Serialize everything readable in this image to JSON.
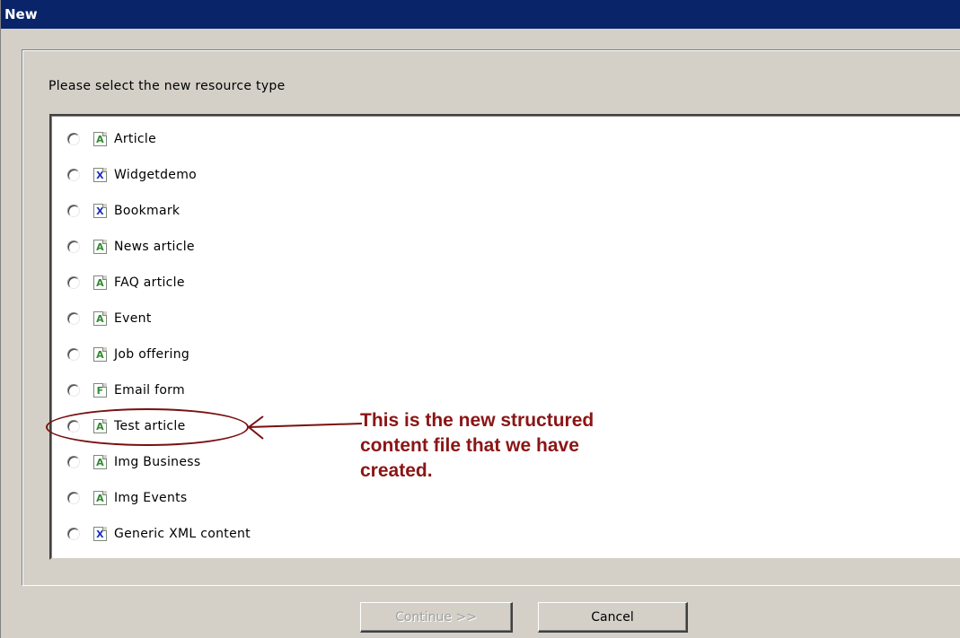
{
  "window": {
    "title": "New"
  },
  "dialog": {
    "prompt": "Please select the new resource type"
  },
  "resource_types": [
    {
      "label": "Article",
      "icon": "article-icon",
      "glyph": "A"
    },
    {
      "label": "Widgetdemo",
      "icon": "xml-icon",
      "glyph": "X"
    },
    {
      "label": "Bookmark",
      "icon": "xml-icon",
      "glyph": "X"
    },
    {
      "label": "News article",
      "icon": "article-icon",
      "glyph": "A"
    },
    {
      "label": "FAQ article",
      "icon": "article-icon",
      "glyph": "A"
    },
    {
      "label": "Event",
      "icon": "article-icon",
      "glyph": "A"
    },
    {
      "label": "Job offering",
      "icon": "article-icon",
      "glyph": "A"
    },
    {
      "label": "Email form",
      "icon": "form-icon",
      "glyph": "F"
    },
    {
      "label": "Test article",
      "icon": "article-icon",
      "glyph": "A"
    },
    {
      "label": "Img Business",
      "icon": "article-icon",
      "glyph": "A"
    },
    {
      "label": "Img Events",
      "icon": "article-icon",
      "glyph": "A"
    },
    {
      "label": "Generic XML content",
      "icon": "xml-icon",
      "glyph": "X"
    }
  ],
  "annotation": {
    "text_line1": "This is the new structured",
    "text_line2": "content file that we have",
    "text_line3": "created.",
    "color": "#8b1515"
  },
  "buttons": {
    "continue_label": "Continue >>",
    "cancel_label": "Cancel"
  },
  "colors": {
    "titlebar": "#0a246a",
    "dialog_bg": "#d4d0c8",
    "icon_article": "#2e8b2e",
    "icon_xml": "#1a2fbf"
  }
}
